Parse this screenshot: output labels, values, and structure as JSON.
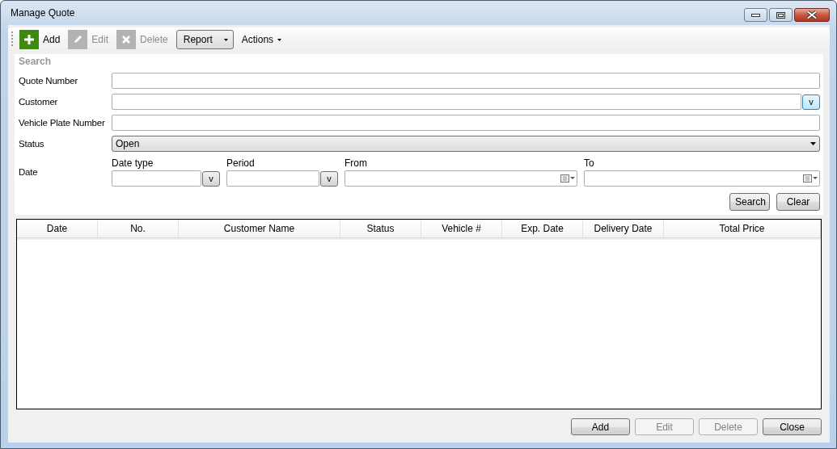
{
  "window": {
    "title": "Manage Quote"
  },
  "toolbar": {
    "items": [
      {
        "kind": "icon-button",
        "label": "Add",
        "disabled": false
      },
      {
        "kind": "icon-button",
        "label": "Edit",
        "disabled": true
      },
      {
        "kind": "icon-button",
        "label": "Delete",
        "disabled": true
      },
      {
        "kind": "dropdown-button",
        "label": "Report"
      },
      {
        "kind": "menu",
        "label": "Actions"
      }
    ]
  },
  "search": {
    "title": "Search",
    "fields": [
      {
        "kind": "text",
        "label": "Quote Number"
      },
      {
        "kind": "lookup",
        "label": "Customer",
        "button": "v"
      },
      {
        "kind": "text",
        "label": "Vehicle Plate Number"
      },
      {
        "kind": "select",
        "label": "Status",
        "value": "Open"
      },
      {
        "kind": "group",
        "label": "Date",
        "parts": [
          {
            "kind": "lookup",
            "label": "Date type",
            "button": "v"
          },
          {
            "kind": "lookup",
            "label": "Period",
            "button": "v"
          },
          {
            "kind": "date",
            "label": "From"
          },
          {
            "kind": "date",
            "label": "To"
          }
        ]
      }
    ],
    "buttons": [
      "Search",
      "Clear"
    ]
  },
  "table": {
    "columns": [
      "Date",
      "No.",
      "Customer Name",
      "Status",
      "Vehicle #",
      "Exp. Date",
      "Delivery Date",
      "Total Price"
    ]
  },
  "buttons": [
    {
      "label": "Add",
      "disabled": false
    },
    {
      "label": "Edit",
      "disabled": true
    },
    {
      "label": "Delete",
      "disabled": true
    },
    {
      "label": "Close",
      "disabled": false
    }
  ]
}
